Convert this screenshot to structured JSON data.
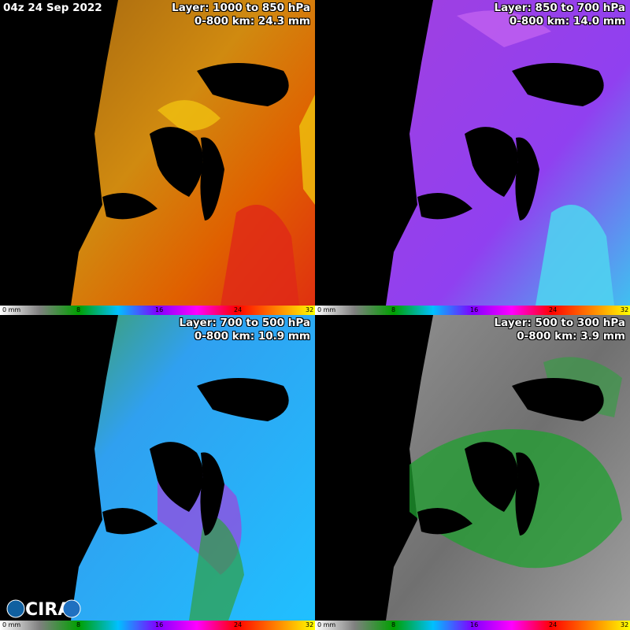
{
  "datestamp": "04z 24 Sep 2022",
  "panels": [
    {
      "layer": "Layer: 1000 to 850 hPa",
      "value": "0-800 km: 24.3 mm",
      "palette": "warm"
    },
    {
      "layer": "Layer: 850 to 700 hPa",
      "value": "0-800 km: 14.0 mm",
      "palette": "violet"
    },
    {
      "layer": "Layer: 700 to 500 hPa",
      "value": "0-800 km: 10.9 mm",
      "palette": "blue"
    },
    {
      "layer": "Layer: 500 to 300 hPa",
      "value": "0-800 km: 3.9 mm",
      "palette": "gray-green"
    }
  ],
  "colorbar": {
    "ticks": [
      "0 mm",
      "8",
      "16",
      "24",
      "32"
    ],
    "tick_values": [
      0,
      8,
      16,
      24,
      32
    ],
    "colors": [
      "#ffffff",
      "#808080",
      "#00a000",
      "#00c0ff",
      "#8000ff",
      "#ff00ff",
      "#ff0000",
      "#ff8000",
      "#ffff00"
    ]
  },
  "logo_text": "CIRA"
}
